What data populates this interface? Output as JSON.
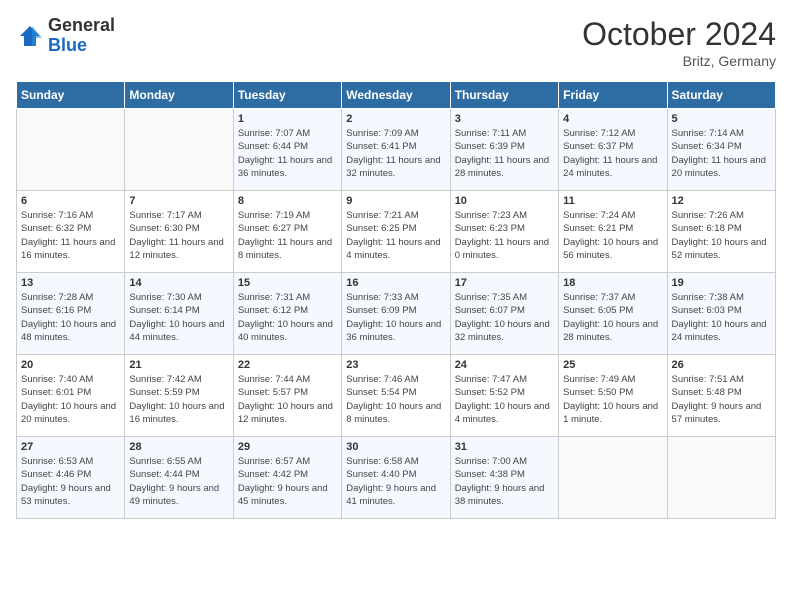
{
  "header": {
    "logo_general": "General",
    "logo_blue": "Blue",
    "month_title": "October 2024",
    "subtitle": "Britz, Germany"
  },
  "weekdays": [
    "Sunday",
    "Monday",
    "Tuesday",
    "Wednesday",
    "Thursday",
    "Friday",
    "Saturday"
  ],
  "weeks": [
    [
      {
        "day": "",
        "content": ""
      },
      {
        "day": "",
        "content": ""
      },
      {
        "day": "1",
        "content": "Sunrise: 7:07 AM\nSunset: 6:44 PM\nDaylight: 11 hours and 36 minutes."
      },
      {
        "day": "2",
        "content": "Sunrise: 7:09 AM\nSunset: 6:41 PM\nDaylight: 11 hours and 32 minutes."
      },
      {
        "day": "3",
        "content": "Sunrise: 7:11 AM\nSunset: 6:39 PM\nDaylight: 11 hours and 28 minutes."
      },
      {
        "day": "4",
        "content": "Sunrise: 7:12 AM\nSunset: 6:37 PM\nDaylight: 11 hours and 24 minutes."
      },
      {
        "day": "5",
        "content": "Sunrise: 7:14 AM\nSunset: 6:34 PM\nDaylight: 11 hours and 20 minutes."
      }
    ],
    [
      {
        "day": "6",
        "content": "Sunrise: 7:16 AM\nSunset: 6:32 PM\nDaylight: 11 hours and 16 minutes."
      },
      {
        "day": "7",
        "content": "Sunrise: 7:17 AM\nSunset: 6:30 PM\nDaylight: 11 hours and 12 minutes."
      },
      {
        "day": "8",
        "content": "Sunrise: 7:19 AM\nSunset: 6:27 PM\nDaylight: 11 hours and 8 minutes."
      },
      {
        "day": "9",
        "content": "Sunrise: 7:21 AM\nSunset: 6:25 PM\nDaylight: 11 hours and 4 minutes."
      },
      {
        "day": "10",
        "content": "Sunrise: 7:23 AM\nSunset: 6:23 PM\nDaylight: 11 hours and 0 minutes."
      },
      {
        "day": "11",
        "content": "Sunrise: 7:24 AM\nSunset: 6:21 PM\nDaylight: 10 hours and 56 minutes."
      },
      {
        "day": "12",
        "content": "Sunrise: 7:26 AM\nSunset: 6:18 PM\nDaylight: 10 hours and 52 minutes."
      }
    ],
    [
      {
        "day": "13",
        "content": "Sunrise: 7:28 AM\nSunset: 6:16 PM\nDaylight: 10 hours and 48 minutes."
      },
      {
        "day": "14",
        "content": "Sunrise: 7:30 AM\nSunset: 6:14 PM\nDaylight: 10 hours and 44 minutes."
      },
      {
        "day": "15",
        "content": "Sunrise: 7:31 AM\nSunset: 6:12 PM\nDaylight: 10 hours and 40 minutes."
      },
      {
        "day": "16",
        "content": "Sunrise: 7:33 AM\nSunset: 6:09 PM\nDaylight: 10 hours and 36 minutes."
      },
      {
        "day": "17",
        "content": "Sunrise: 7:35 AM\nSunset: 6:07 PM\nDaylight: 10 hours and 32 minutes."
      },
      {
        "day": "18",
        "content": "Sunrise: 7:37 AM\nSunset: 6:05 PM\nDaylight: 10 hours and 28 minutes."
      },
      {
        "day": "19",
        "content": "Sunrise: 7:38 AM\nSunset: 6:03 PM\nDaylight: 10 hours and 24 minutes."
      }
    ],
    [
      {
        "day": "20",
        "content": "Sunrise: 7:40 AM\nSunset: 6:01 PM\nDaylight: 10 hours and 20 minutes."
      },
      {
        "day": "21",
        "content": "Sunrise: 7:42 AM\nSunset: 5:59 PM\nDaylight: 10 hours and 16 minutes."
      },
      {
        "day": "22",
        "content": "Sunrise: 7:44 AM\nSunset: 5:57 PM\nDaylight: 10 hours and 12 minutes."
      },
      {
        "day": "23",
        "content": "Sunrise: 7:46 AM\nSunset: 5:54 PM\nDaylight: 10 hours and 8 minutes."
      },
      {
        "day": "24",
        "content": "Sunrise: 7:47 AM\nSunset: 5:52 PM\nDaylight: 10 hours and 4 minutes."
      },
      {
        "day": "25",
        "content": "Sunrise: 7:49 AM\nSunset: 5:50 PM\nDaylight: 10 hours and 1 minute."
      },
      {
        "day": "26",
        "content": "Sunrise: 7:51 AM\nSunset: 5:48 PM\nDaylight: 9 hours and 57 minutes."
      }
    ],
    [
      {
        "day": "27",
        "content": "Sunrise: 6:53 AM\nSunset: 4:46 PM\nDaylight: 9 hours and 53 minutes."
      },
      {
        "day": "28",
        "content": "Sunrise: 6:55 AM\nSunset: 4:44 PM\nDaylight: 9 hours and 49 minutes."
      },
      {
        "day": "29",
        "content": "Sunrise: 6:57 AM\nSunset: 4:42 PM\nDaylight: 9 hours and 45 minutes."
      },
      {
        "day": "30",
        "content": "Sunrise: 6:58 AM\nSunset: 4:40 PM\nDaylight: 9 hours and 41 minutes."
      },
      {
        "day": "31",
        "content": "Sunrise: 7:00 AM\nSunset: 4:38 PM\nDaylight: 9 hours and 38 minutes."
      },
      {
        "day": "",
        "content": ""
      },
      {
        "day": "",
        "content": ""
      }
    ]
  ]
}
